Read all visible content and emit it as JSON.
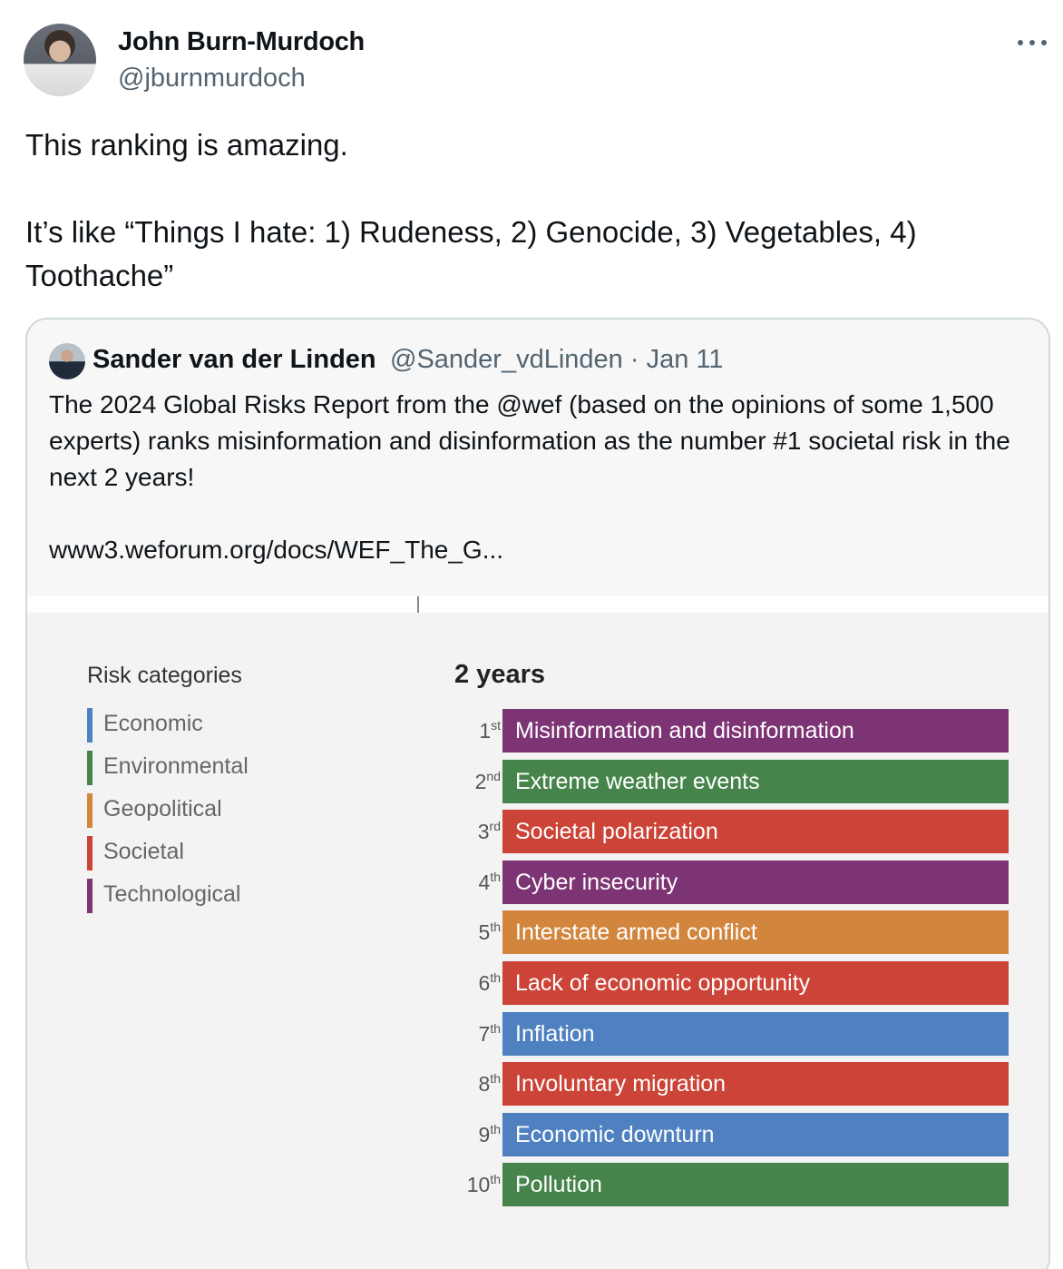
{
  "tweet": {
    "author_name": "John Burn-Murdoch",
    "author_handle": "@jburnmurdoch",
    "text": "This ranking is amazing.\n\nIt’s like “Things I hate: 1) Rudeness, 2) Genocide, 3) Vegetables, 4) Toothache”",
    "more_icon": "more-horizontal-icon"
  },
  "quoted_tweet": {
    "author_name": "Sander van der Linden",
    "meta": "@Sander_vdLinden · Jan 11",
    "text": "The 2024 Global Risks Report from the @wef (based on the opinions of some 1,500 experts) ranks misinformation and disinformation as the number #1 societal risk in the next 2 years!\n\nwww3.weforum.org/docs/WEF_The_G..."
  },
  "report": {
    "legend_title": "Risk categories",
    "categories": [
      {
        "label": "Economic",
        "color": "#4f81c0"
      },
      {
        "label": "Environmental",
        "color": "#46844b"
      },
      {
        "label": "Geopolitical",
        "color": "#d2853d"
      },
      {
        "label": "Societal",
        "color": "#cc4337"
      },
      {
        "label": "Technological",
        "color": "#7d3474"
      }
    ],
    "ranking_title": "2 years",
    "ranks": [
      {
        "num": "1",
        "suffix": "st",
        "label": "Misinformation and disinformation",
        "category": "Technological",
        "color": "#7d3474"
      },
      {
        "num": "2",
        "suffix": "nd",
        "label": "Extreme weather events",
        "category": "Environmental",
        "color": "#46844b"
      },
      {
        "num": "3",
        "suffix": "rd",
        "label": "Societal polarization",
        "category": "Societal",
        "color": "#cc4337"
      },
      {
        "num": "4",
        "suffix": "th",
        "label": "Cyber insecurity",
        "category": "Technological",
        "color": "#7d3474"
      },
      {
        "num": "5",
        "suffix": "th",
        "label": "Interstate armed conflict",
        "category": "Geopolitical",
        "color": "#d2853d"
      },
      {
        "num": "6",
        "suffix": "th",
        "label": "Lack of economic opportunity",
        "category": "Societal",
        "color": "#cc4337"
      },
      {
        "num": "7",
        "suffix": "th",
        "label": "Inflation",
        "category": "Economic",
        "color": "#4f81c0"
      },
      {
        "num": "8",
        "suffix": "th",
        "label": "Involuntary migration",
        "category": "Societal",
        "color": "#cc4337"
      },
      {
        "num": "9",
        "suffix": "th",
        "label": "Economic downturn",
        "category": "Economic",
        "color": "#4f81c0"
      },
      {
        "num": "10",
        "suffix": "th",
        "label": "Pollution",
        "category": "Environmental",
        "color": "#46844b"
      }
    ]
  }
}
